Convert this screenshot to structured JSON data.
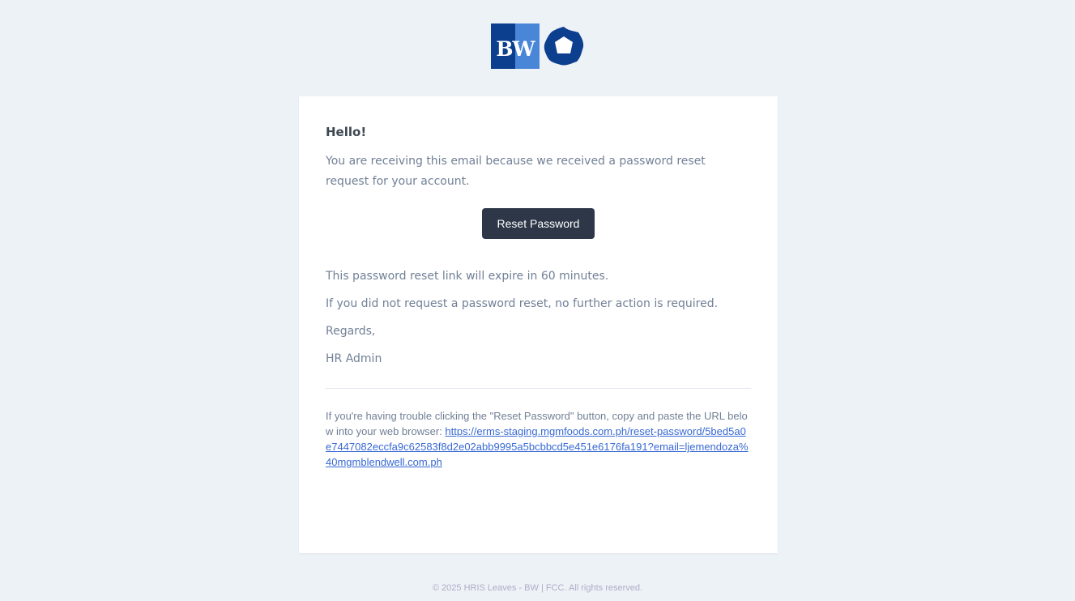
{
  "header": {
    "logo_text": "BW",
    "logo_icon": "flower-logo-icon",
    "colors": {
      "dark_blue": "#0d3f8f",
      "light_blue": "#4a86d8"
    }
  },
  "email": {
    "greeting": "Hello!",
    "intro": "You are receiving this email because we received a password reset request for your account.",
    "button_label": "Reset Password",
    "expire_note": "This password reset link will expire in 60 minutes.",
    "no_action_note": "If you did not request a password reset, no further action is required.",
    "salutation": "Regards,",
    "signature": "HR Admin",
    "subcopy_text": "If you're having trouble clicking the \"Reset Password\" button, copy and paste the URL below into your web browser: ",
    "reset_url": "https://erms-staging.mgmfoods.com.ph/reset-password/5bed5a0e7447082eccfa9c62583f8d2e02abb9995a5bcbbcd5e451e6176fa191?email=ljemendoza%40mgmblendwell.com.ph"
  },
  "footer": {
    "copyright": "© 2025 HRIS Leaves - BW | FCC. All rights reserved."
  },
  "colors": {
    "background": "#edf2f7",
    "card": "#ffffff",
    "button": "#2d3748",
    "text_muted": "#718096",
    "link": "#3869d4"
  }
}
